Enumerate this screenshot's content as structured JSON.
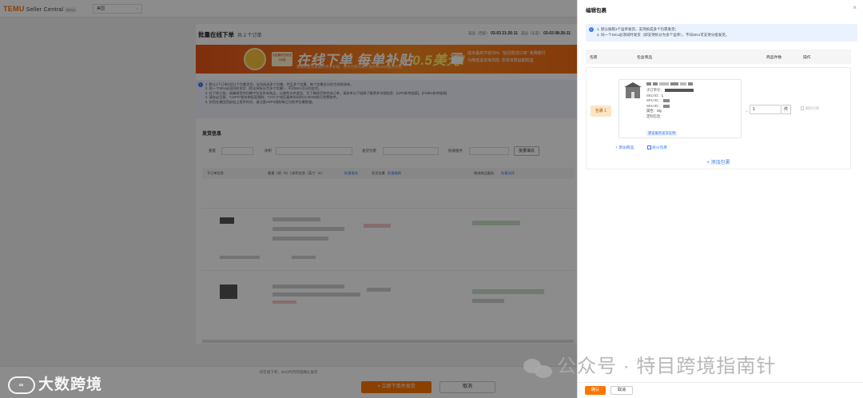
{
  "app": {
    "logo": "TEMU",
    "logo_sub": "Seller Central",
    "logo_badge": "Beta",
    "region": "美国"
  },
  "page": {
    "title": "批量在线下单",
    "order_count": "共 2 个订单",
    "time_label_1": "美国（西部）",
    "time_value_1": "03-03 21:26:11",
    "time_label_2": "美国（东部）",
    "time_value_2": "03-03 08:26:11"
  },
  "banner": {
    "mini_text": "大促最终狂欢至3月底",
    "headline_a": "在线下单 每单补贴",
    "headline_b": "0.5美元!",
    "sub": "旗舰明星商家面对更多补贴，合作仓库可兼计划获得130w美元补贴",
    "tag": "限时补贴",
    "bullets": [
      "成本最高节省25%",
      "为降低退货率风险",
      "\"延迟揽货订单\" 免降额付",
      "享受单费延期权益"
    ]
  },
  "notices": [
    "1. 默认1个订单对应1个包裹发货，支持拆成多个包裹，并且多个包裹，每个包裹会分别生成物流单。",
    "2. 同一个SKU必须同时发货（即支持拆分为多个包裹），不同SKU可分别发货。",
    "3. 在下单之前，请确保您的包裹中包含所有商品，以避免仓库退回，为了确保尽快完成订单，请参考以下链接了解更多详细信息：[UPS参考链接]，[FedEx参考链接]",
    "4. 请务必注意，\"USPS\"服务商距离限制，\"UTC-0\"地区截单时间约21:59:59前可免费取件。",
    "5. 如您在美国西部加上揽件时间，请注意USPS限制每日可揽件包裹数量。"
  ],
  "shipping": {
    "section_title": "发货信息",
    "filter_weight": "重量",
    "filter_size": "体积",
    "filter_carrier": "发货包裹",
    "filter_pickup": "揽收服务",
    "batch_fill": "批量填充",
    "col_order": "子订单信息",
    "col_weight": "重量（磅 · lb）| 体积信息（英寸 · in）",
    "col_weight_link": "批量填充",
    "col_package": "发货包裹",
    "col_package_link": "批量编辑",
    "col_logistics": "物流商品服务",
    "col_logistics_link": "批量选择"
  },
  "footer": {
    "note": "仅在线下单，20小时内完成确认发货",
    "submit": "立即下单并发货",
    "cancel": "取消"
  },
  "drawer": {
    "title": "编辑包裹",
    "close": "×",
    "tips": [
      "1. 默认按照1个运单发货，支持拆成多个包裹发货；",
      "2. 同一个SKU必须同时发货（即支持拆分为多个运单），不同SKU可支持分批发货。"
    ],
    "col_package": "包裹",
    "col_items": "包含商品",
    "col_qty": "商品件数",
    "col_action": "操作",
    "package_label": "包裹 1",
    "sku": {
      "order_label": "子订单号：",
      "sku_id_label": "SKU ID：",
      "sku_id_value": "1",
      "spu_id_label": "SPU ID：",
      "sku_ids_label": "SKU ID：",
      "attr_label": "属性：",
      "attr_value": "Sty",
      "custom_label": "定制信息：",
      "custom_placeholder": "",
      "link": "建议服务发货证明"
    },
    "qty_value": "1",
    "qty_unit": "件",
    "delete_package": "删除包裹",
    "add_product": "添加商品",
    "split_package": "拆分包裹",
    "add_package": "添加包裹",
    "confirm": "确认",
    "cancel": "取消"
  },
  "watermarks": {
    "left": "大数跨境",
    "right": "公众号 · 特目跨境指南针"
  }
}
